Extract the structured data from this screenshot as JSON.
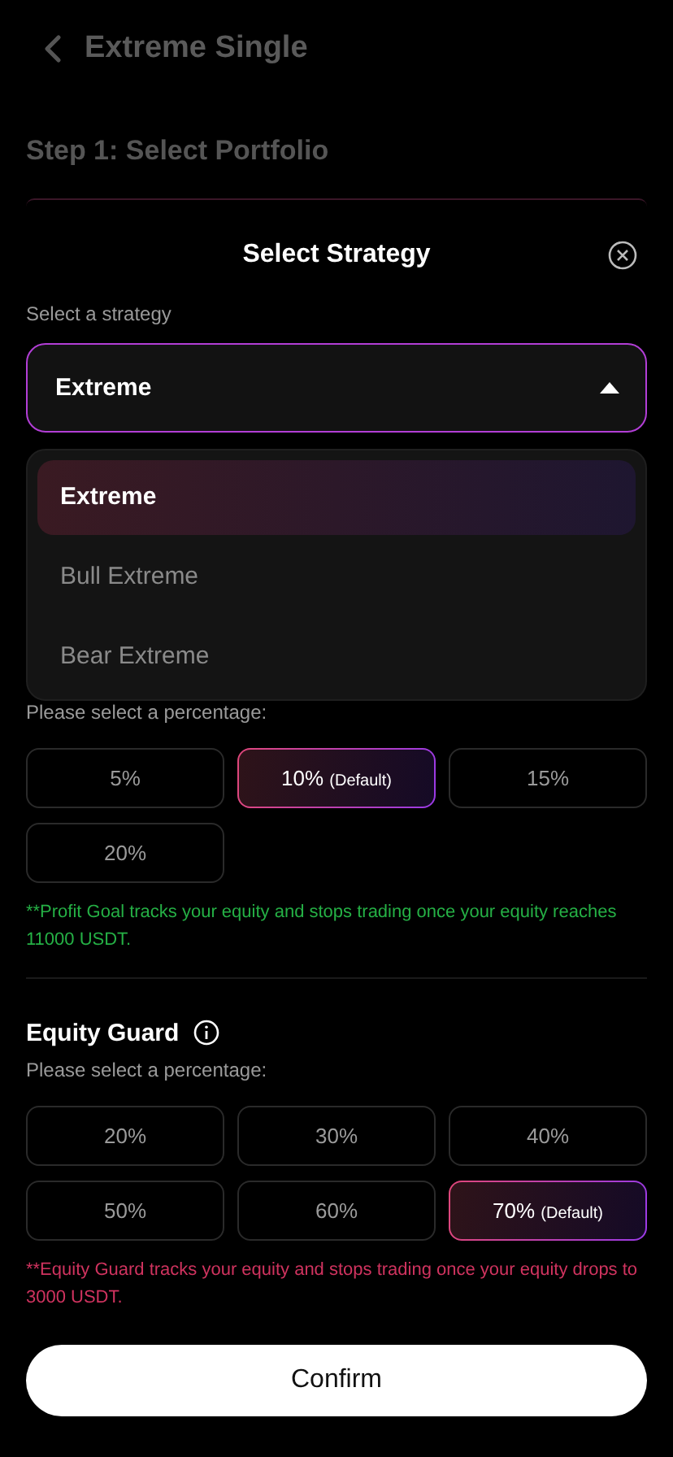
{
  "background": {
    "title": "Extreme Single",
    "step_title": "Step 1: Select Portfolio"
  },
  "sheet": {
    "title": "Select Strategy",
    "strategy_label": "Select a strategy",
    "strategy_select": {
      "value": "Extreme",
      "expanded": true
    },
    "strategy_options": [
      {
        "label": "Extreme",
        "selected": true
      },
      {
        "label": "Bull Extreme",
        "selected": false
      },
      {
        "label": "Bear Extreme",
        "selected": false
      }
    ],
    "profit_goal": {
      "label": "Please select a percentage:",
      "options": [
        {
          "label": "5%",
          "selected": false
        },
        {
          "label": "10%",
          "tag": "(Default)",
          "selected": true
        },
        {
          "label": "15%",
          "selected": false
        },
        {
          "label": "20%",
          "selected": false
        }
      ],
      "note": "**Profit Goal tracks your equity and stops trading once your equity reaches 11000 USDT."
    },
    "equity_guard": {
      "title": "Equity Guard",
      "label": "Please select a percentage:",
      "options": [
        {
          "label": "20%",
          "selected": false
        },
        {
          "label": "30%",
          "selected": false
        },
        {
          "label": "40%",
          "selected": false
        },
        {
          "label": "50%",
          "selected": false
        },
        {
          "label": "60%",
          "selected": false
        },
        {
          "label": "70%",
          "tag": "(Default)",
          "selected": true
        }
      ],
      "note": "**Equity Guard tracks your equity and stops trading once your equity drops to 3000 USDT."
    },
    "confirm": "Confirm"
  }
}
